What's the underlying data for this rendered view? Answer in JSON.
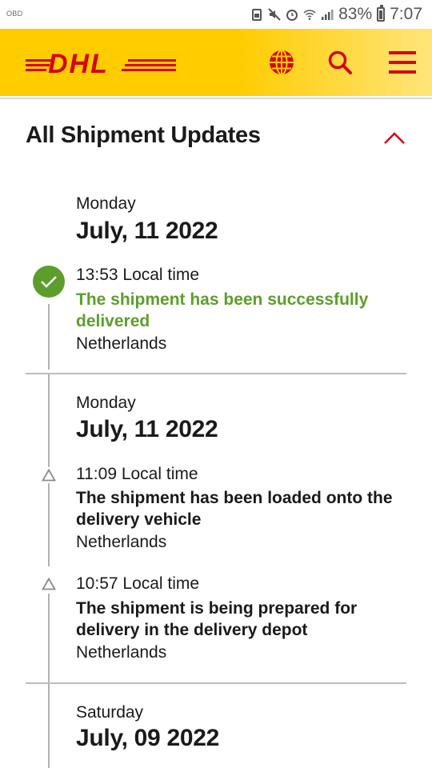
{
  "status_bar": {
    "carrier": "OBD",
    "battery": "83%",
    "time": "7:07"
  },
  "header": {
    "logo_text": "DHL",
    "brand_yellow": "#ffcc00",
    "brand_red": "#d40511",
    "icons": [
      "globe-icon",
      "search-icon",
      "menu-icon"
    ]
  },
  "section": {
    "title": "All Shipment Updates",
    "toggle_icon": "chevron-up-icon"
  },
  "groups": [
    {
      "day": "Monday",
      "date": "July, 11 2022",
      "events": [
        {
          "time": "13:53 Local time",
          "text": "The shipment has been successfully delivered",
          "location": "Netherlands",
          "status": "delivered"
        }
      ]
    },
    {
      "day": "Monday",
      "date": "July, 11 2022",
      "events": [
        {
          "time": "11:09 Local time",
          "text": "The shipment has been loaded onto the delivery vehicle",
          "location": "Netherlands",
          "status": "transit"
        },
        {
          "time": "10:57 Local time",
          "text": "The shipment is being prepared for delivery in the delivery depot",
          "location": "Netherlands",
          "status": "transit"
        }
      ]
    },
    {
      "day": "Saturday",
      "date": "July, 09 2022",
      "events": []
    }
  ],
  "colors": {
    "delivered_green": "#5c9e2b",
    "timeline_gray": "#b3b3b3"
  }
}
